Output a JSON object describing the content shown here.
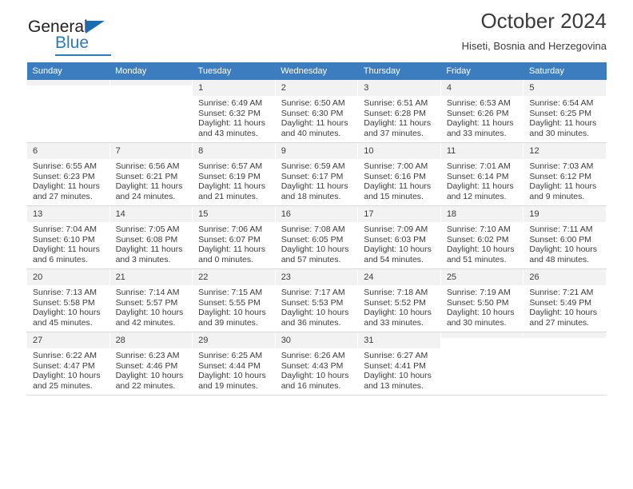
{
  "brand": {
    "name_top": "General",
    "name_bottom": "Blue",
    "triangle_icon": "triangle-icon",
    "accent_color": "#2a7ac0"
  },
  "header": {
    "title": "October 2024",
    "subtitle": "Hiseti, Bosnia and Herzegovina"
  },
  "calendar": {
    "header_bg": "#3c7dbf",
    "weekdays": [
      "Sunday",
      "Monday",
      "Tuesday",
      "Wednesday",
      "Thursday",
      "Friday",
      "Saturday"
    ],
    "weeks": [
      [
        {
          "day": "",
          "sunrise": "",
          "sunset": "",
          "daylight": "",
          "daylight2": ""
        },
        {
          "day": "",
          "sunrise": "",
          "sunset": "",
          "daylight": "",
          "daylight2": ""
        },
        {
          "day": "1",
          "sunrise": "Sunrise: 6:49 AM",
          "sunset": "Sunset: 6:32 PM",
          "daylight": "Daylight: 11 hours",
          "daylight2": "and 43 minutes."
        },
        {
          "day": "2",
          "sunrise": "Sunrise: 6:50 AM",
          "sunset": "Sunset: 6:30 PM",
          "daylight": "Daylight: 11 hours",
          "daylight2": "and 40 minutes."
        },
        {
          "day": "3",
          "sunrise": "Sunrise: 6:51 AM",
          "sunset": "Sunset: 6:28 PM",
          "daylight": "Daylight: 11 hours",
          "daylight2": "and 37 minutes."
        },
        {
          "day": "4",
          "sunrise": "Sunrise: 6:53 AM",
          "sunset": "Sunset: 6:26 PM",
          "daylight": "Daylight: 11 hours",
          "daylight2": "and 33 minutes."
        },
        {
          "day": "5",
          "sunrise": "Sunrise: 6:54 AM",
          "sunset": "Sunset: 6:25 PM",
          "daylight": "Daylight: 11 hours",
          "daylight2": "and 30 minutes."
        }
      ],
      [
        {
          "day": "6",
          "sunrise": "Sunrise: 6:55 AM",
          "sunset": "Sunset: 6:23 PM",
          "daylight": "Daylight: 11 hours",
          "daylight2": "and 27 minutes."
        },
        {
          "day": "7",
          "sunrise": "Sunrise: 6:56 AM",
          "sunset": "Sunset: 6:21 PM",
          "daylight": "Daylight: 11 hours",
          "daylight2": "and 24 minutes."
        },
        {
          "day": "8",
          "sunrise": "Sunrise: 6:57 AM",
          "sunset": "Sunset: 6:19 PM",
          "daylight": "Daylight: 11 hours",
          "daylight2": "and 21 minutes."
        },
        {
          "day": "9",
          "sunrise": "Sunrise: 6:59 AM",
          "sunset": "Sunset: 6:17 PM",
          "daylight": "Daylight: 11 hours",
          "daylight2": "and 18 minutes."
        },
        {
          "day": "10",
          "sunrise": "Sunrise: 7:00 AM",
          "sunset": "Sunset: 6:16 PM",
          "daylight": "Daylight: 11 hours",
          "daylight2": "and 15 minutes."
        },
        {
          "day": "11",
          "sunrise": "Sunrise: 7:01 AM",
          "sunset": "Sunset: 6:14 PM",
          "daylight": "Daylight: 11 hours",
          "daylight2": "and 12 minutes."
        },
        {
          "day": "12",
          "sunrise": "Sunrise: 7:03 AM",
          "sunset": "Sunset: 6:12 PM",
          "daylight": "Daylight: 11 hours",
          "daylight2": "and 9 minutes."
        }
      ],
      [
        {
          "day": "13",
          "sunrise": "Sunrise: 7:04 AM",
          "sunset": "Sunset: 6:10 PM",
          "daylight": "Daylight: 11 hours",
          "daylight2": "and 6 minutes."
        },
        {
          "day": "14",
          "sunrise": "Sunrise: 7:05 AM",
          "sunset": "Sunset: 6:08 PM",
          "daylight": "Daylight: 11 hours",
          "daylight2": "and 3 minutes."
        },
        {
          "day": "15",
          "sunrise": "Sunrise: 7:06 AM",
          "sunset": "Sunset: 6:07 PM",
          "daylight": "Daylight: 11 hours",
          "daylight2": "and 0 minutes."
        },
        {
          "day": "16",
          "sunrise": "Sunrise: 7:08 AM",
          "sunset": "Sunset: 6:05 PM",
          "daylight": "Daylight: 10 hours",
          "daylight2": "and 57 minutes."
        },
        {
          "day": "17",
          "sunrise": "Sunrise: 7:09 AM",
          "sunset": "Sunset: 6:03 PM",
          "daylight": "Daylight: 10 hours",
          "daylight2": "and 54 minutes."
        },
        {
          "day": "18",
          "sunrise": "Sunrise: 7:10 AM",
          "sunset": "Sunset: 6:02 PM",
          "daylight": "Daylight: 10 hours",
          "daylight2": "and 51 minutes."
        },
        {
          "day": "19",
          "sunrise": "Sunrise: 7:11 AM",
          "sunset": "Sunset: 6:00 PM",
          "daylight": "Daylight: 10 hours",
          "daylight2": "and 48 minutes."
        }
      ],
      [
        {
          "day": "20",
          "sunrise": "Sunrise: 7:13 AM",
          "sunset": "Sunset: 5:58 PM",
          "daylight": "Daylight: 10 hours",
          "daylight2": "and 45 minutes."
        },
        {
          "day": "21",
          "sunrise": "Sunrise: 7:14 AM",
          "sunset": "Sunset: 5:57 PM",
          "daylight": "Daylight: 10 hours",
          "daylight2": "and 42 minutes."
        },
        {
          "day": "22",
          "sunrise": "Sunrise: 7:15 AM",
          "sunset": "Sunset: 5:55 PM",
          "daylight": "Daylight: 10 hours",
          "daylight2": "and 39 minutes."
        },
        {
          "day": "23",
          "sunrise": "Sunrise: 7:17 AM",
          "sunset": "Sunset: 5:53 PM",
          "daylight": "Daylight: 10 hours",
          "daylight2": "and 36 minutes."
        },
        {
          "day": "24",
          "sunrise": "Sunrise: 7:18 AM",
          "sunset": "Sunset: 5:52 PM",
          "daylight": "Daylight: 10 hours",
          "daylight2": "and 33 minutes."
        },
        {
          "day": "25",
          "sunrise": "Sunrise: 7:19 AM",
          "sunset": "Sunset: 5:50 PM",
          "daylight": "Daylight: 10 hours",
          "daylight2": "and 30 minutes."
        },
        {
          "day": "26",
          "sunrise": "Sunrise: 7:21 AM",
          "sunset": "Sunset: 5:49 PM",
          "daylight": "Daylight: 10 hours",
          "daylight2": "and 27 minutes."
        }
      ],
      [
        {
          "day": "27",
          "sunrise": "Sunrise: 6:22 AM",
          "sunset": "Sunset: 4:47 PM",
          "daylight": "Daylight: 10 hours",
          "daylight2": "and 25 minutes."
        },
        {
          "day": "28",
          "sunrise": "Sunrise: 6:23 AM",
          "sunset": "Sunset: 4:46 PM",
          "daylight": "Daylight: 10 hours",
          "daylight2": "and 22 minutes."
        },
        {
          "day": "29",
          "sunrise": "Sunrise: 6:25 AM",
          "sunset": "Sunset: 4:44 PM",
          "daylight": "Daylight: 10 hours",
          "daylight2": "and 19 minutes."
        },
        {
          "day": "30",
          "sunrise": "Sunrise: 6:26 AM",
          "sunset": "Sunset: 4:43 PM",
          "daylight": "Daylight: 10 hours",
          "daylight2": "and 16 minutes."
        },
        {
          "day": "31",
          "sunrise": "Sunrise: 6:27 AM",
          "sunset": "Sunset: 4:41 PM",
          "daylight": "Daylight: 10 hours",
          "daylight2": "and 13 minutes."
        },
        {
          "day": "",
          "sunrise": "",
          "sunset": "",
          "daylight": "",
          "daylight2": ""
        },
        {
          "day": "",
          "sunrise": "",
          "sunset": "",
          "daylight": "",
          "daylight2": ""
        }
      ]
    ]
  }
}
